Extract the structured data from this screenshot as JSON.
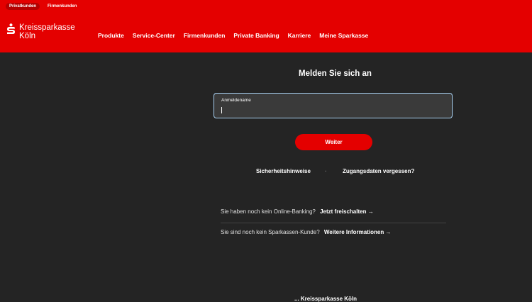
{
  "header": {
    "segments": [
      "Privatkunden",
      "Firmenkunden"
    ],
    "brand_line1": "Kreissparkasse",
    "brand_line2": "Köln",
    "nav": [
      "Produkte",
      "Service-Center",
      "Firmenkunden",
      "Private Banking",
      "Karriere",
      "Meine Sparkasse"
    ],
    "color": "#e40000"
  },
  "login": {
    "title": "Melden Sie sich an",
    "username_label": "Anmeldename",
    "username_value": "",
    "continue_label": "Weiter",
    "security_link": "Sicherheitshinweise",
    "separator": "·",
    "forgot_link": "Zugangsdaten vergessen?"
  },
  "promos": [
    {
      "question": "Sie haben noch kein Online-Banking?",
      "action": "Jetzt freischalten →"
    },
    {
      "question": "Sie sind noch kein Sparkassen-Kunde?",
      "action": "Weitere Informationen →"
    }
  ],
  "footer": {
    "partial_text": "... Kreissparkasse Köln"
  },
  "icons": {
    "logo": "sparkasse-s-logo",
    "arrow": "arrow-right-icon"
  },
  "colors": {
    "background": "#242424",
    "field_border": "#a7cff0",
    "accent": "#e40000"
  }
}
